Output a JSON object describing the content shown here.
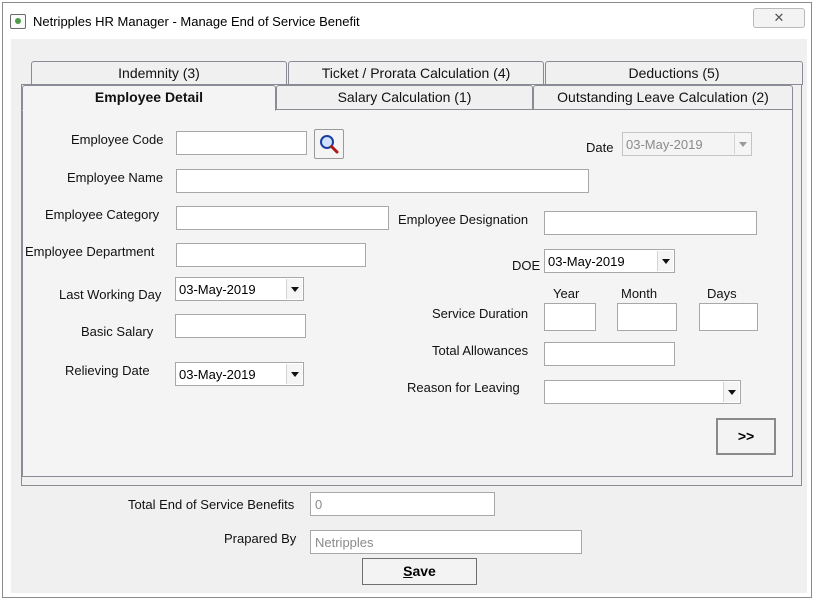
{
  "window": {
    "title": "Netripples HR Manager - Manage End of Service Benefit",
    "close_glyph": "✕"
  },
  "tabs": {
    "back_row": [
      "Indemnity (3)",
      "Ticket / Prorata Calculation (4)",
      "Deductions (5)"
    ],
    "front_row": [
      "Employee Detail",
      "Salary Calculation (1)",
      "Outstanding Leave Calculation (2)"
    ],
    "active": "Employee Detail"
  },
  "form": {
    "employee_code": {
      "label": "Employee Code",
      "value": ""
    },
    "date": {
      "label": "Date",
      "value": "03-May-2019"
    },
    "employee_name": {
      "label": "Employee Name",
      "value": ""
    },
    "employee_category": {
      "label": "Employee Category",
      "value": ""
    },
    "employee_designation": {
      "label": "Employee Designation",
      "value": ""
    },
    "employee_department": {
      "label": "Employee Department",
      "value": ""
    },
    "doe": {
      "label": "DOE",
      "value": "03-May-2019"
    },
    "last_working_day": {
      "label": "Last Working Day",
      "value": "03-May-2019"
    },
    "service_duration": {
      "label": "Service Duration",
      "year_label": "Year",
      "month_label": "Month",
      "days_label": "Days",
      "year": "",
      "month": "",
      "days": ""
    },
    "basic_salary": {
      "label": "Basic Salary",
      "value": ""
    },
    "total_allowances": {
      "label": "Total Allowances",
      "value": ""
    },
    "relieving_date": {
      "label": "Relieving  Date",
      "value": "03-May-2019"
    },
    "reason_for_leaving": {
      "label": "Reason for Leaving",
      "value": ""
    },
    "next_button": ">>"
  },
  "footer": {
    "total_eosb": {
      "label": "Total End of Service Benefits",
      "value": "0"
    },
    "prepared_by": {
      "label": "Prapared By",
      "value": "Netripples"
    },
    "save_label_prefix": "",
    "save_label_underlined": "S",
    "save_label_rest": "ave"
  },
  "icons": {
    "app": "app-icon",
    "search": "magnifier-icon",
    "dropdown": "chevron-down-icon"
  }
}
